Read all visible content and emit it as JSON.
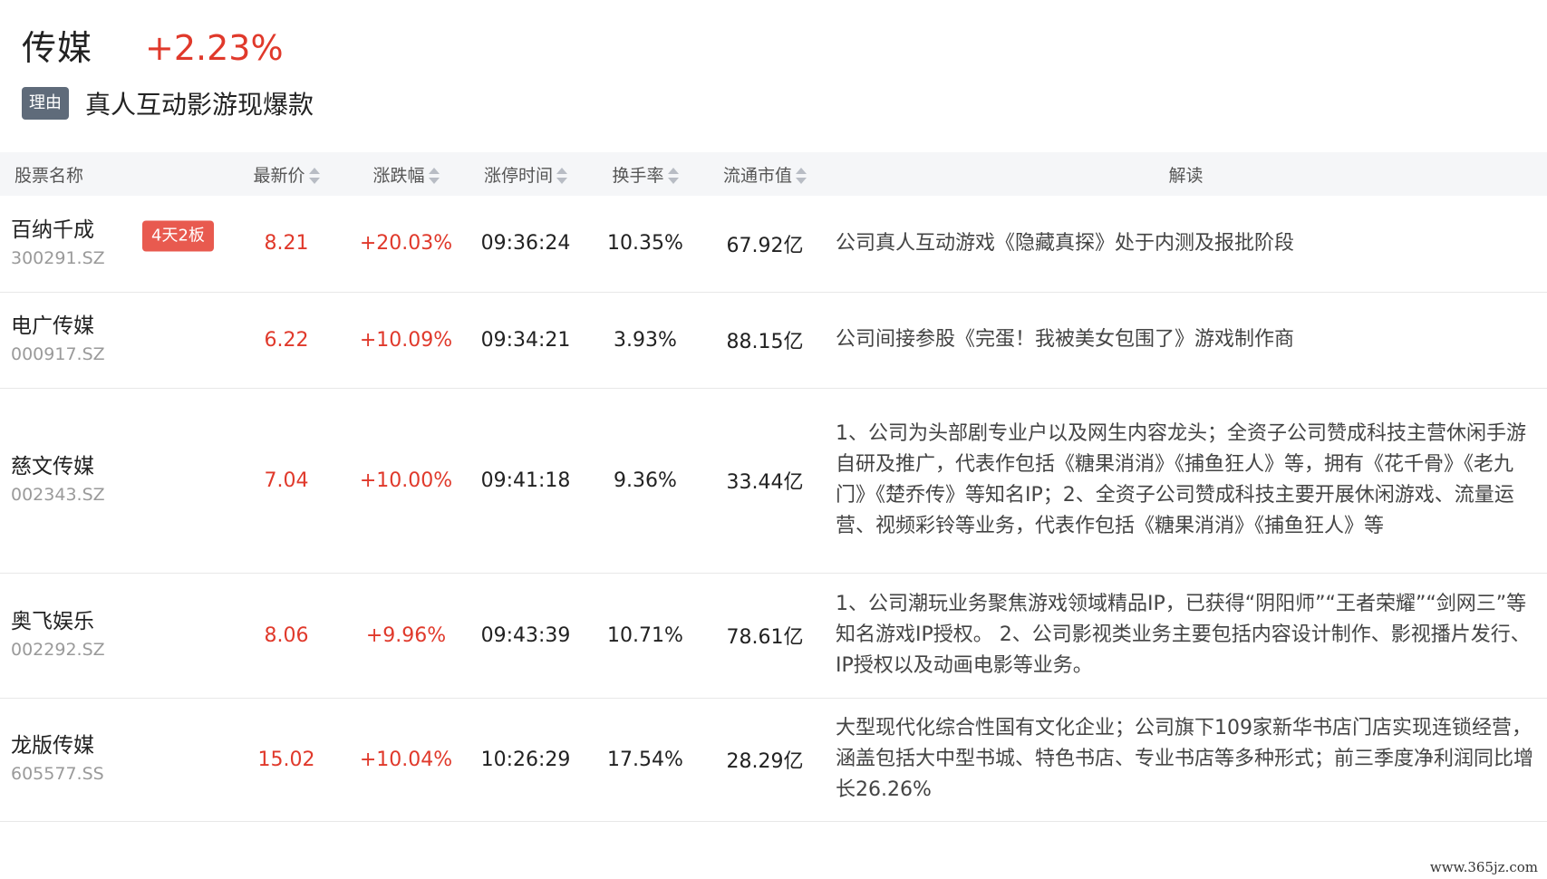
{
  "sector": {
    "name": "传媒",
    "change": "+2.23%"
  },
  "reason": {
    "tag": "理由",
    "text": "真人互动影游现爆款"
  },
  "table": {
    "headers": {
      "name": "股票名称",
      "price": "最新价",
      "change": "涨跌幅",
      "limit_time": "涨停时间",
      "turnover": "换手率",
      "market_cap": "流通市值",
      "desc": "解读"
    },
    "rows": [
      {
        "name": "百纳千成",
        "code": "300291.SZ",
        "badge": "4天2板",
        "price": "8.21",
        "change": "+20.03%",
        "time": "09:36:24",
        "turnover": "10.35%",
        "cap": "67.92亿",
        "desc": "公司真人互动游戏《隐藏真探》处于内测及报批阶段"
      },
      {
        "name": "电广传媒",
        "code": "000917.SZ",
        "badge": "",
        "price": "6.22",
        "change": "+10.09%",
        "time": "09:34:21",
        "turnover": "3.93%",
        "cap": "88.15亿",
        "desc": "公司间接参股《完蛋！我被美女包围了》游戏制作商"
      },
      {
        "name": "慈文传媒",
        "code": "002343.SZ",
        "badge": "",
        "price": "7.04",
        "change": "+10.00%",
        "time": "09:41:18",
        "turnover": "9.36%",
        "cap": "33.44亿",
        "desc": "1、公司为头部剧专业户以及网生内容龙头；全资子公司赞成科技主营休闲手游自研及推广，代表作包括《糖果消消》《捕鱼狂人》等，拥有《花千骨》《老九门》《楚乔传》等知名IP；2、全资子公司赞成科技主要开展休闲游戏、流量运营、视频彩铃等业务，代表作包括《糖果消消》《捕鱼狂人》等"
      },
      {
        "name": "奥飞娱乐",
        "code": "002292.SZ",
        "badge": "",
        "price": "8.06",
        "change": "+9.96%",
        "time": "09:43:39",
        "turnover": "10.71%",
        "cap": "78.61亿",
        "desc": "1、公司潮玩业务聚焦游戏领域精品IP，已获得“阴阳师”“王者荣耀”“剑网三”等知名游戏IP授权。 2、公司影视类业务主要包括内容设计制作、影视播片发行、IP授权以及动画电影等业务。"
      },
      {
        "name": "龙版传媒",
        "code": "605577.SS",
        "badge": "",
        "price": "15.02",
        "change": "+10.04%",
        "time": "10:26:29",
        "turnover": "17.54%",
        "cap": "28.29亿",
        "desc": "大型现代化综合性国有文化企业；公司旗下109家新华书店门店实现连锁经营，涵盖包括大中型书城、特色书店、专业书店等多种形式；前三季度净利润同比增长26.26%"
      }
    ]
  },
  "watermark": "www.365jz.com"
}
